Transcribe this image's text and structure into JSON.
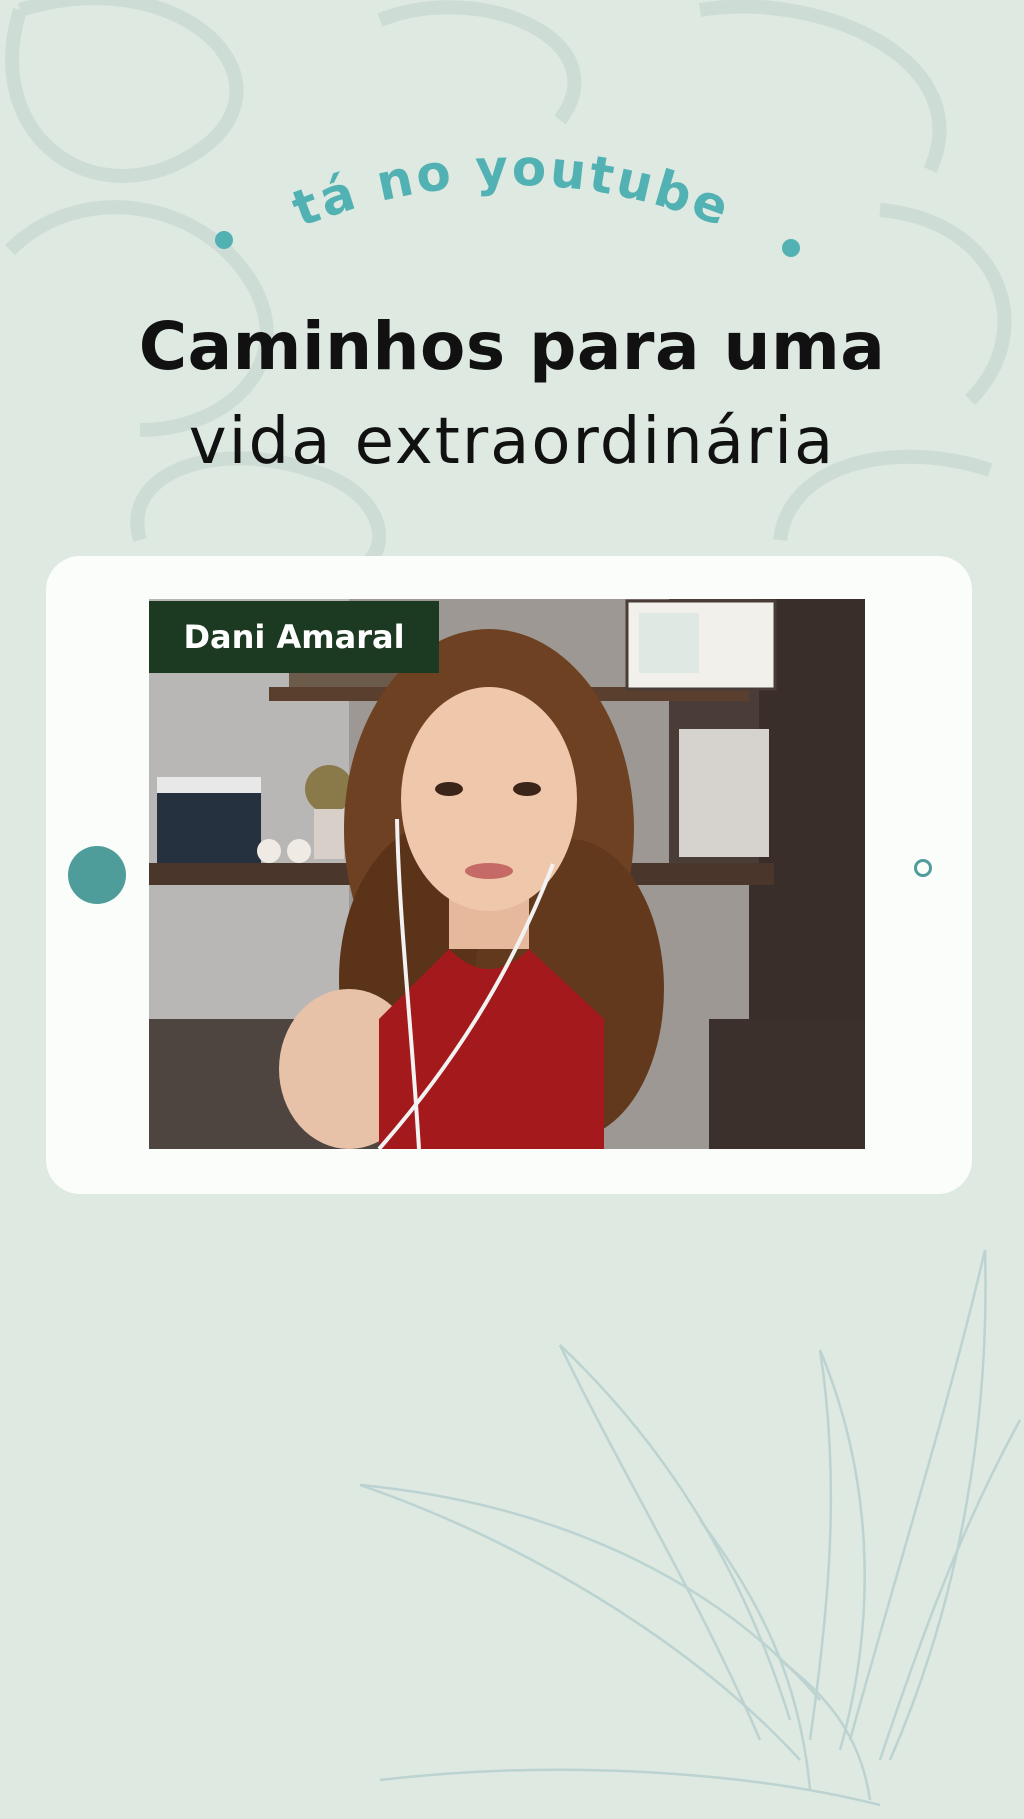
{
  "header": {
    "kicker": "tá no youtube",
    "headline_bold": "Caminhos para uma",
    "headline_light": "vida extraordinária"
  },
  "video": {
    "participant_name": "Dani Amaral"
  },
  "colors": {
    "background": "#dde9e1",
    "accent_teal": "#52b1b2",
    "device_frame": "#fbfdfb",
    "name_tag": "#1c3a22"
  }
}
